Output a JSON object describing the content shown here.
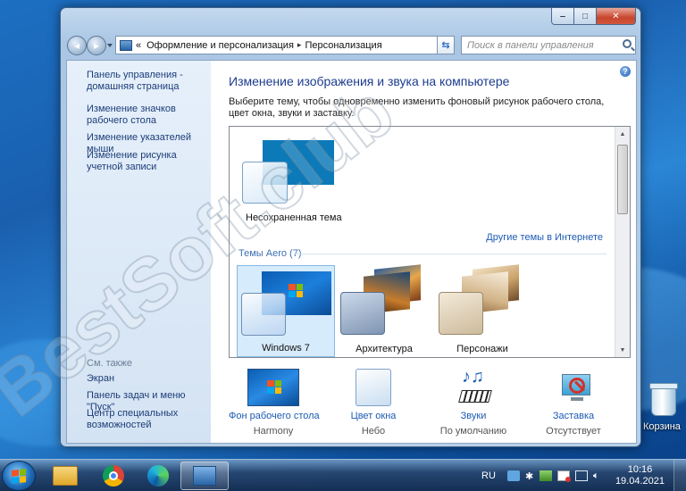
{
  "window": {
    "minimize_glyph": "‒",
    "maximize_glyph": "□",
    "close_glyph": "✕"
  },
  "address": {
    "prefix": "«",
    "segments": [
      "Оформление и персонализация",
      "Персонализация"
    ],
    "separator": "▸"
  },
  "search": {
    "placeholder": "Поиск в панели управления"
  },
  "sidebar": {
    "home": "Панель управления - домашняя страница",
    "links": [
      "Изменение значков рабочего стола",
      "Изменение указателей мыши",
      "Изменение рисунка учетной записи"
    ],
    "see_also_header": "См. также",
    "see_also": [
      "Экран",
      "Панель задач и меню \"Пуск\"",
      "Центр специальных возможностей"
    ]
  },
  "main": {
    "title": "Изменение изображения и звука на компьютере",
    "description": "Выберите тему, чтобы одновременно изменить фоновый рисунок рабочего стола, цвет окна, звуки и заставку.",
    "unsaved_theme": "Несохраненная тема",
    "more_themes_link": "Другие темы в Интернете",
    "aero_group": "Темы Aero (7)",
    "themes": [
      "Windows 7",
      "Архитектура",
      "Персонажи"
    ]
  },
  "bottom": [
    {
      "link": "Фон рабочего стола",
      "sub": "Harmony",
      "icon": "desktop-background-icon"
    },
    {
      "link": "Цвет окна",
      "sub": "Небо",
      "icon": "window-color-icon"
    },
    {
      "link": "Звуки",
      "sub": "По умолчанию",
      "icon": "sounds-icon"
    },
    {
      "link": "Заставка",
      "sub": "Отсутствует",
      "icon": "screensaver-icon"
    }
  ],
  "desktop": {
    "recycle_bin": "Корзина"
  },
  "watermark": "BestSoft.club",
  "taskbar": {
    "lang": "RU",
    "time": "10:16",
    "date": "19.04.2021"
  }
}
